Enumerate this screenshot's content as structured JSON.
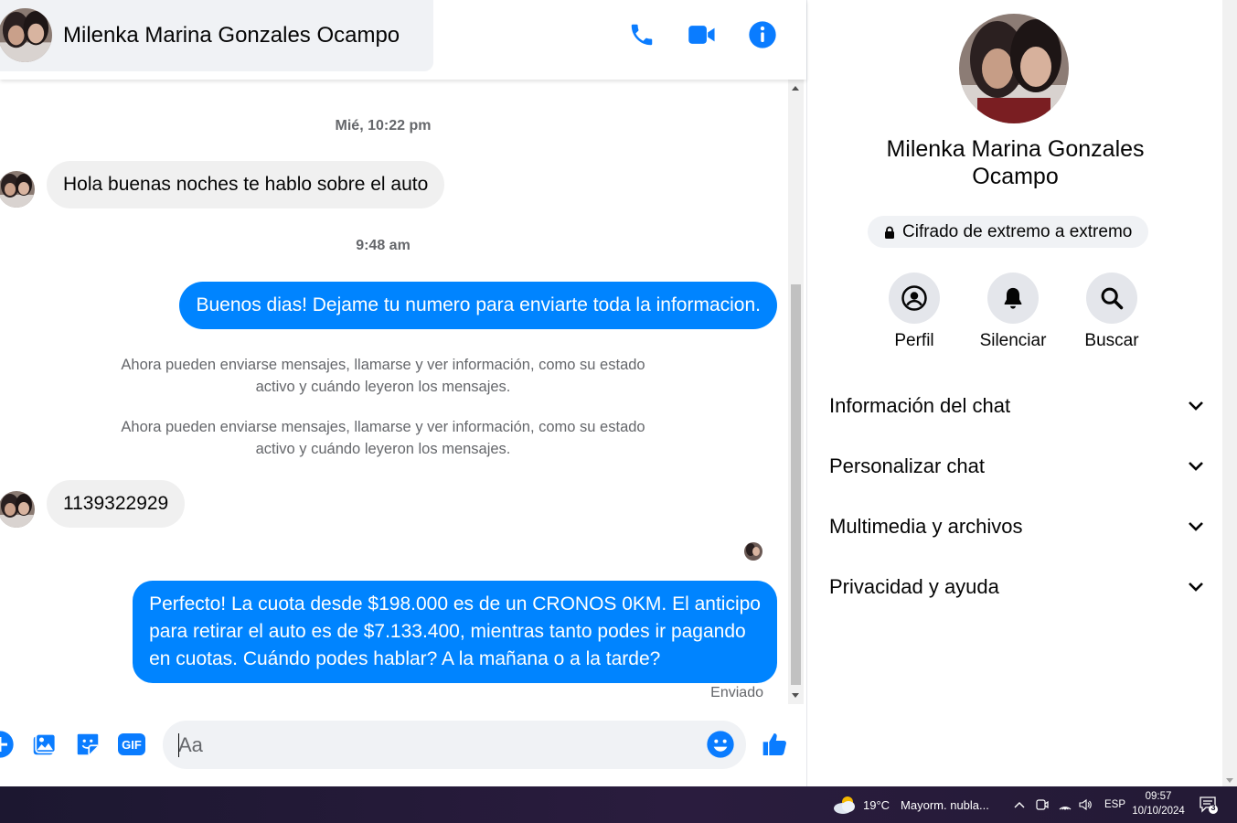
{
  "header": {
    "contact_name": "Milenka Marina Gonzales Ocampo",
    "icons": [
      "phone-icon",
      "video-camera-icon",
      "info-icon"
    ]
  },
  "messages": {
    "timestamp_1": "Mié, 10:22 pm",
    "msg_1": "Hola buenas noches te hablo sobre el auto",
    "timestamp_2": "9:48 am",
    "msg_2": "Buenos dias! Dejame tu numero para enviarte toda la informacion.",
    "system_1_line1": "Ahora pueden enviarse mensajes, llamarse y ver información, como su estado",
    "system_1_line2": "activo y cuándo leyeron los mensajes.",
    "system_2_line1": "Ahora pueden enviarse mensajes, llamarse y ver información, como su estado",
    "system_2_line2": "activo y cuándo leyeron los mensajes.",
    "msg_3": "1139322929",
    "msg_4_line1": "Perfecto! La cuota desde $198.000 es de un CRONOS 0KM. El anticipo",
    "msg_4_line2": "para retirar el auto es de $7.133.400, mientras tanto podes ir pagando",
    "msg_4_line3": "en cuotas. Cuándo podes hablar? A la mañana o a la tarde?",
    "sent_status": "Enviado"
  },
  "composer": {
    "placeholder": "Aa",
    "icons": [
      "plus-icon",
      "photo-icon",
      "sticker-icon",
      "gif-icon",
      "emoji-icon",
      "thumbs-up-icon"
    ],
    "gif_label": "GIF"
  },
  "info_panel": {
    "name_line1": "Milenka Marina Gonzales",
    "name_line2": "Ocampo",
    "encryption_label": "Cifrado de extremo a extremo",
    "actions": [
      {
        "label": "Perfil",
        "icon": "profile-icon"
      },
      {
        "label": "Silenciar",
        "icon": "bell-icon"
      },
      {
        "label": "Buscar",
        "icon": "search-icon"
      }
    ],
    "sections": [
      {
        "label": "Información del chat"
      },
      {
        "label": "Personalizar chat"
      },
      {
        "label": "Multimedia y archivos"
      },
      {
        "label": "Privacidad y ayuda"
      }
    ]
  },
  "taskbar": {
    "weather_temp": "19°C",
    "weather_text": "Mayorm. nubla...",
    "language": "ESP",
    "time": "09:57",
    "date": "10/10/2024",
    "notification_count": "3"
  },
  "colors": {
    "accent": "#0084ff",
    "incoming_bubble": "#f0f0f0",
    "secondary_text": "#65676b"
  }
}
